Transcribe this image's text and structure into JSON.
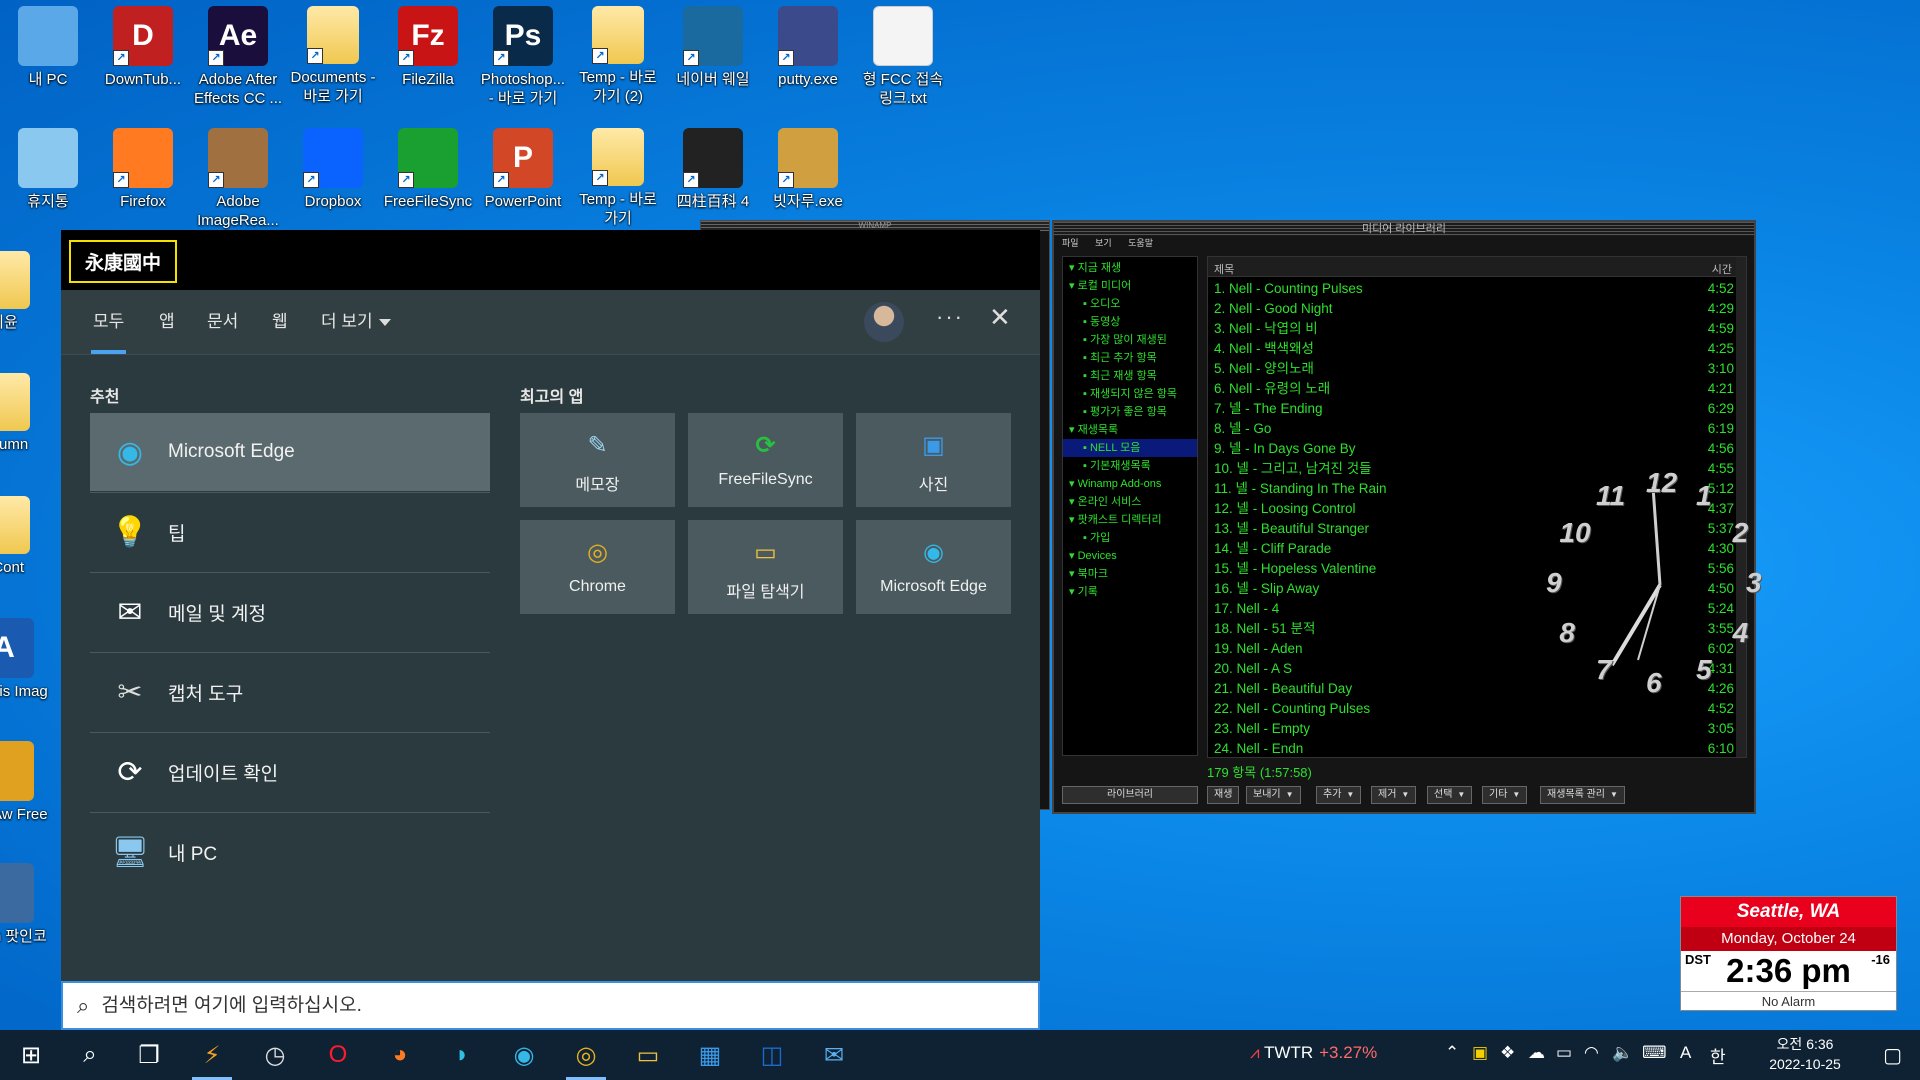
{
  "desktop": {
    "icons": [
      {
        "label": "내 PC",
        "icon": "pc-icon"
      },
      {
        "label": "DownTub...",
        "icon": "downtube-icon",
        "glyph": "D"
      },
      {
        "label": "Adobe After Effects CC ...",
        "icon": "after-effects-icon",
        "glyph": "Ae"
      },
      {
        "label": "Documents - 바로 가기",
        "icon": "folder-icon"
      },
      {
        "label": "FileZilla",
        "icon": "filezilla-icon",
        "glyph": "Fz"
      },
      {
        "label": "Photoshop... - 바로 가기",
        "icon": "photoshop-icon",
        "glyph": "Ps"
      },
      {
        "label": "Temp - 바로 가기 (2)",
        "icon": "folder-icon"
      },
      {
        "label": "네이버 웨일",
        "icon": "whale-icon"
      },
      {
        "label": "putty.exe",
        "icon": "putty-icon"
      },
      {
        "label": "형 FCC 접속 링크.txt",
        "icon": "text-file-icon"
      },
      {
        "label": "휴지통",
        "icon": "recycle-bin-icon"
      },
      {
        "label": "Firefox",
        "icon": "firefox-icon"
      },
      {
        "label": "Adobe ImageRea...",
        "icon": "imageready-icon"
      },
      {
        "label": "Dropbox",
        "icon": "dropbox-icon"
      },
      {
        "label": "FreeFileSync",
        "icon": "freefilesync-icon"
      },
      {
        "label": "PowerPoint",
        "icon": "powerpoint-icon",
        "glyph": "P"
      },
      {
        "label": "Temp - 바로 가기",
        "icon": "folder-icon"
      },
      {
        "label": "四柱百科 4",
        "icon": "yinyang-icon"
      },
      {
        "label": "빗자루.exe",
        "icon": "broom-icon"
      },
      {
        "label": "이윤",
        "icon": "folder-icon"
      },
      {
        "label": "column",
        "icon": "folder-icon"
      },
      {
        "label": "dCont",
        "icon": "folder-icon"
      },
      {
        "label": "Acronis Imag",
        "icon": "acronis-icon",
        "glyph": "A"
      },
      {
        "label": "BurnAw Free",
        "icon": "burnaware-icon"
      },
      {
        "label": "Daum 팟인코",
        "icon": "daum-potencoder-icon"
      }
    ]
  },
  "search_panel": {
    "title": "永康國中",
    "tabs": [
      "모두",
      "앱",
      "문서",
      "웹",
      "더 보기"
    ],
    "recommended_title": "추천",
    "recommended": [
      {
        "label": "Microsoft Edge",
        "icon": "edge-icon"
      },
      {
        "label": "팁",
        "icon": "tips-icon"
      },
      {
        "label": "메일 및 계정",
        "icon": "mail-icon"
      },
      {
        "label": "캡처 도구",
        "icon": "snipping-tool-icon"
      },
      {
        "label": "업데이트 확인",
        "icon": "update-icon"
      },
      {
        "label": "내 PC",
        "icon": "pc-icon"
      }
    ],
    "top_apps_title": "최고의 앱",
    "top_apps": [
      {
        "label": "메모장",
        "icon": "notepad-icon"
      },
      {
        "label": "FreeFileSync",
        "icon": "freefilesync-icon"
      },
      {
        "label": "사진",
        "icon": "photos-icon"
      },
      {
        "label": "Chrome",
        "icon": "chrome-icon"
      },
      {
        "label": "파일 탐색기",
        "icon": "file-explorer-icon"
      },
      {
        "label": "Microsoft Edge",
        "icon": "edge-icon"
      }
    ],
    "search_placeholder": "검색하려면 여기에 입력하십시오."
  },
  "winamp": {
    "title": "WINAMP",
    "library_title": "미디어 라이브러리",
    "menu": [
      "파일",
      "보기",
      "도움말"
    ],
    "tree": [
      {
        "label": "지금 재생",
        "indent": 0
      },
      {
        "label": "로컬 미디어",
        "indent": 0
      },
      {
        "label": "오디오",
        "indent": 1
      },
      {
        "label": "동영상",
        "indent": 1
      },
      {
        "label": "가장 많이 재생된",
        "indent": 1
      },
      {
        "label": "최근 추가 항목",
        "indent": 1
      },
      {
        "label": "최근 재생 항목",
        "indent": 1
      },
      {
        "label": "재생되지 않은 항목",
        "indent": 1
      },
      {
        "label": "평가가 좋은 항목",
        "indent": 1
      },
      {
        "label": "재생목록",
        "indent": 0
      },
      {
        "label": "NELL 모음",
        "indent": 1,
        "selected": true
      },
      {
        "label": "기본재생목록",
        "indent": 1
      },
      {
        "label": "Winamp Add-ons",
        "indent": 0
      },
      {
        "label": "온라인 서비스",
        "indent": 0
      },
      {
        "label": "팟캐스트 디렉터리",
        "indent": 0
      },
      {
        "label": "가입",
        "indent": 1
      },
      {
        "label": "Devices",
        "indent": 0
      },
      {
        "label": "북마크",
        "indent": 0
      },
      {
        "label": "기록",
        "indent": 0
      }
    ],
    "columns": {
      "title": "제목",
      "time": "시간"
    },
    "tracks": [
      {
        "title": "1. Nell - Counting Pulses",
        "time": "4:52"
      },
      {
        "title": "2. Nell - Good Night",
        "time": "4:29"
      },
      {
        "title": "3. Nell - 낙엽의 비",
        "time": "4:59"
      },
      {
        "title": "4. Nell - 백색왜성",
        "time": "4:25"
      },
      {
        "title": "5. Nell - 양의노래",
        "time": "3:10"
      },
      {
        "title": "6. Nell - 유령의 노래",
        "time": "4:21"
      },
      {
        "title": "7. 넬 - The Ending",
        "time": "6:29"
      },
      {
        "title": "8. 넬 - Go",
        "time": "6:19"
      },
      {
        "title": "9. 넬 - In Days Gone By",
        "time": "4:56"
      },
      {
        "title": "10. 넬 - 그리고, 남겨진 것들",
        "time": "4:55"
      },
      {
        "title": "11. 넬 - Standing In The Rain",
        "time": "5:12"
      },
      {
        "title": "12. 넬 - Loosing Control",
        "time": "4:37"
      },
      {
        "title": "13. 넬 - Beautiful Stranger",
        "time": "5:37"
      },
      {
        "title": "14. 넬 - Cliff Parade",
        "time": "4:30"
      },
      {
        "title": "15. 넬 - Hopeless Valentine",
        "time": "5:56"
      },
      {
        "title": "16. 넬 - Slip Away",
        "time": "4:50"
      },
      {
        "title": "17. Nell - 4",
        "time": "5:24"
      },
      {
        "title": "18. Nell - 51 분적",
        "time": "3:55"
      },
      {
        "title": "19. Nell - Aden",
        "time": "6:02"
      },
      {
        "title": "20. Nell - A S",
        "time": "4:31"
      },
      {
        "title": "21. Nell - Beautiful Day",
        "time": "4:26"
      },
      {
        "title": "22. Nell - Counting Pulses",
        "time": "4:52"
      },
      {
        "title": "23. Nell - Empty",
        "time": "3:05"
      },
      {
        "title": "24. Nell - Endn",
        "time": "6:10"
      }
    ],
    "status": "179 항목 (1:57:58)",
    "library_button": "라이브러리",
    "buttons": [
      "재생",
      "보내기",
      "추가",
      "제거",
      "선택",
      "기타",
      "재생목록 관리"
    ]
  },
  "clock_numbers": [
    "12",
    "1",
    "2",
    "3",
    "4",
    "5",
    "6",
    "7",
    "8",
    "9",
    "10",
    "11"
  ],
  "weather_clock": {
    "city": "Seattle, WA",
    "date": "Monday, October 24",
    "dst": "DST",
    "time": "2:36 pm",
    "offset": "-16",
    "alarm": "No Alarm"
  },
  "taskbar": {
    "apps": [
      "start-icon",
      "search-icon",
      "task-view-icon",
      "winamp-icon",
      "clock-app-icon",
      "opera-icon",
      "firefox-icon",
      "whale-icon",
      "edge-icon",
      "chrome-icon",
      "file-explorer-icon",
      "store-icon",
      "outlook-icon",
      "mail-icon"
    ],
    "stock_symbol": "TWTR",
    "stock_change": "+3.27%",
    "ime_mode": "A",
    "ime_lang": "한",
    "time": "오전 6:36",
    "date": "2022-10-25"
  },
  "colors": {
    "accent": "#4aa3f0",
    "winamp_green": "#2ee02e",
    "clock_red": "#e8001c"
  }
}
